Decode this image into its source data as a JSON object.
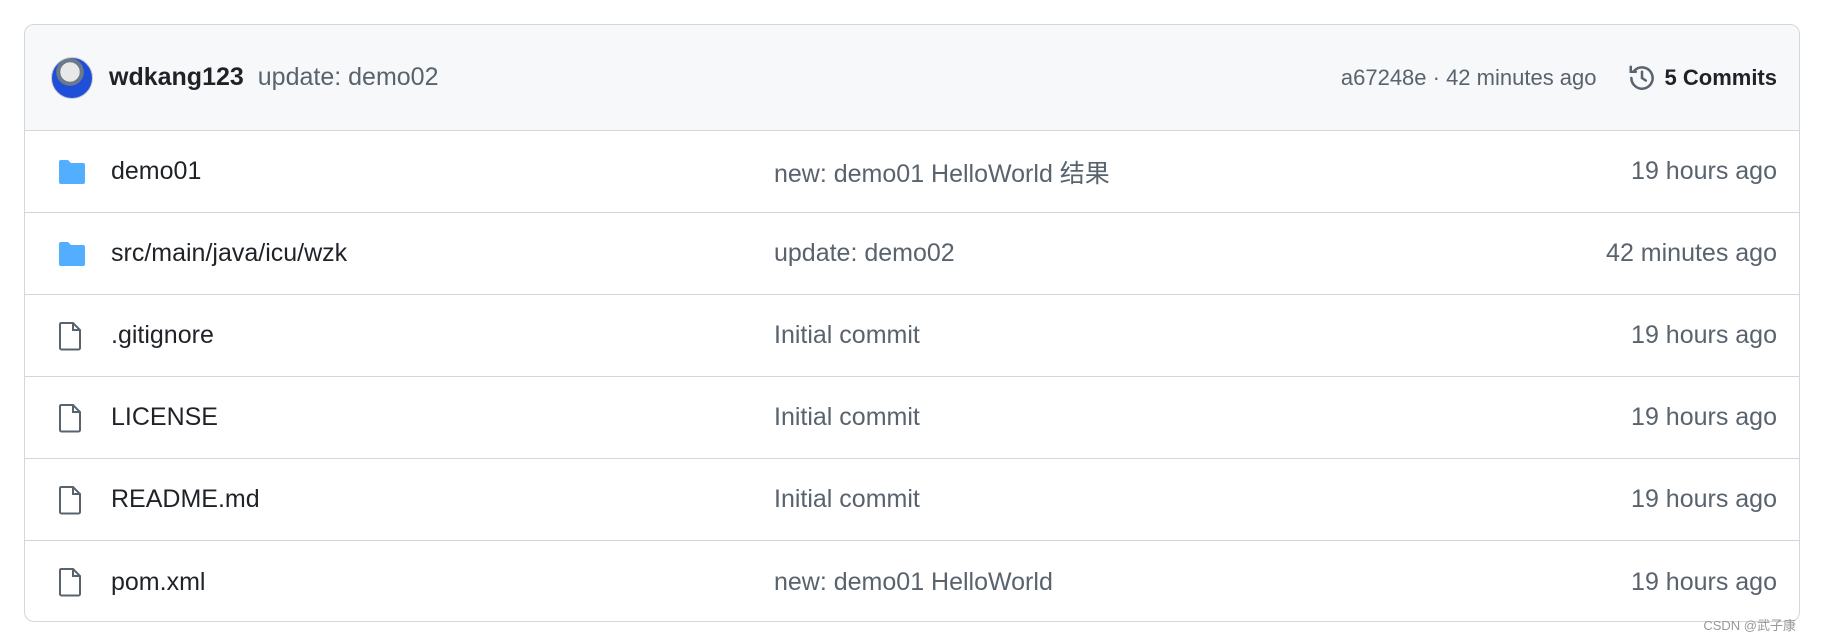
{
  "header": {
    "user": "wdkang123",
    "message": "update: demo02",
    "sha_time": "a67248e · 42 minutes ago",
    "commits_label": "5 Commits",
    "commits_icon": "history-icon"
  },
  "files": [
    {
      "type": "folder",
      "name": "demo01",
      "message": "new: demo01 HelloWorld 结果",
      "date": "19 hours ago"
    },
    {
      "type": "folder",
      "name": "src/main/java/icu/wzk",
      "message": "update: demo02",
      "date": "42 minutes ago"
    },
    {
      "type": "file",
      "name": ".gitignore",
      "message": "Initial commit",
      "date": "19 hours ago"
    },
    {
      "type": "file",
      "name": "LICENSE",
      "message": "Initial commit",
      "date": "19 hours ago"
    },
    {
      "type": "file",
      "name": "README.md",
      "message": "Initial commit",
      "date": "19 hours ago"
    },
    {
      "type": "file",
      "name": "pom.xml",
      "message": "new: demo01 HelloWorld",
      "date": "19 hours ago"
    }
  ],
  "colors": {
    "folder": "#54aeff",
    "border": "#d0d7de",
    "header_bg": "#f6f8fa"
  },
  "watermark": "CSDN @武子康"
}
